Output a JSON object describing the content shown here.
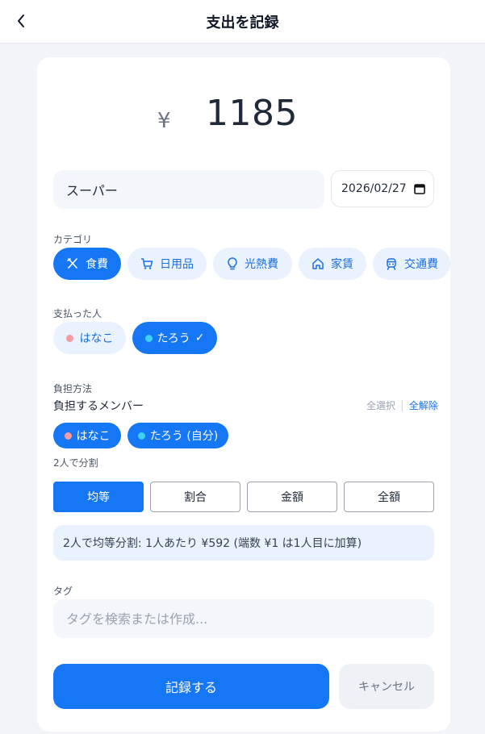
{
  "header": {
    "title": "支出を記録",
    "back_icon": "chevron-left-icon"
  },
  "amount": {
    "currency": "¥",
    "value": "1185"
  },
  "description": {
    "value": "スーパー"
  },
  "date": {
    "value": "2026/02/27"
  },
  "category": {
    "label": "カテゴリ",
    "items": [
      {
        "label": "食費",
        "icon": "utensils-icon",
        "selected": true
      },
      {
        "label": "日用品",
        "icon": "cart-icon",
        "selected": false
      },
      {
        "label": "光熱費",
        "icon": "lightbulb-icon",
        "selected": false
      },
      {
        "label": "家賃",
        "icon": "home-icon",
        "selected": false
      },
      {
        "label": "交通費",
        "icon": "train-icon",
        "selected": false
      }
    ]
  },
  "payer": {
    "label": "支払った人",
    "items": [
      {
        "label": "はなこ",
        "color": "#f59ca2",
        "selected": false
      },
      {
        "label": "たろう",
        "color": "#3fd1f2",
        "selected": true,
        "check": "✓"
      }
    ]
  },
  "burden": {
    "label": "負担方法",
    "members_label": "負担するメンバー",
    "select_all": "全選択",
    "separator": "|",
    "clear_all": "全解除",
    "members": [
      {
        "label": "はなこ",
        "color": "#f59ca2"
      },
      {
        "label": "たろう (自分)",
        "color": "#3fd1f2"
      }
    ],
    "split_count": "2人で分割",
    "methods": [
      "均等",
      "割合",
      "金額",
      "全額"
    ],
    "selected_method": "均等",
    "info": "2人で均等分割: 1人あたり ¥592 (端数 ¥1 は1人目に加算)"
  },
  "tag": {
    "label": "タグ",
    "placeholder": "タグを検索または作成..."
  },
  "actions": {
    "submit": "記録する",
    "cancel": "キャンセル"
  },
  "colors": {
    "primary": "#1677f5",
    "chip_bg": "#e9f2fd",
    "background": "#f2f4f7"
  }
}
